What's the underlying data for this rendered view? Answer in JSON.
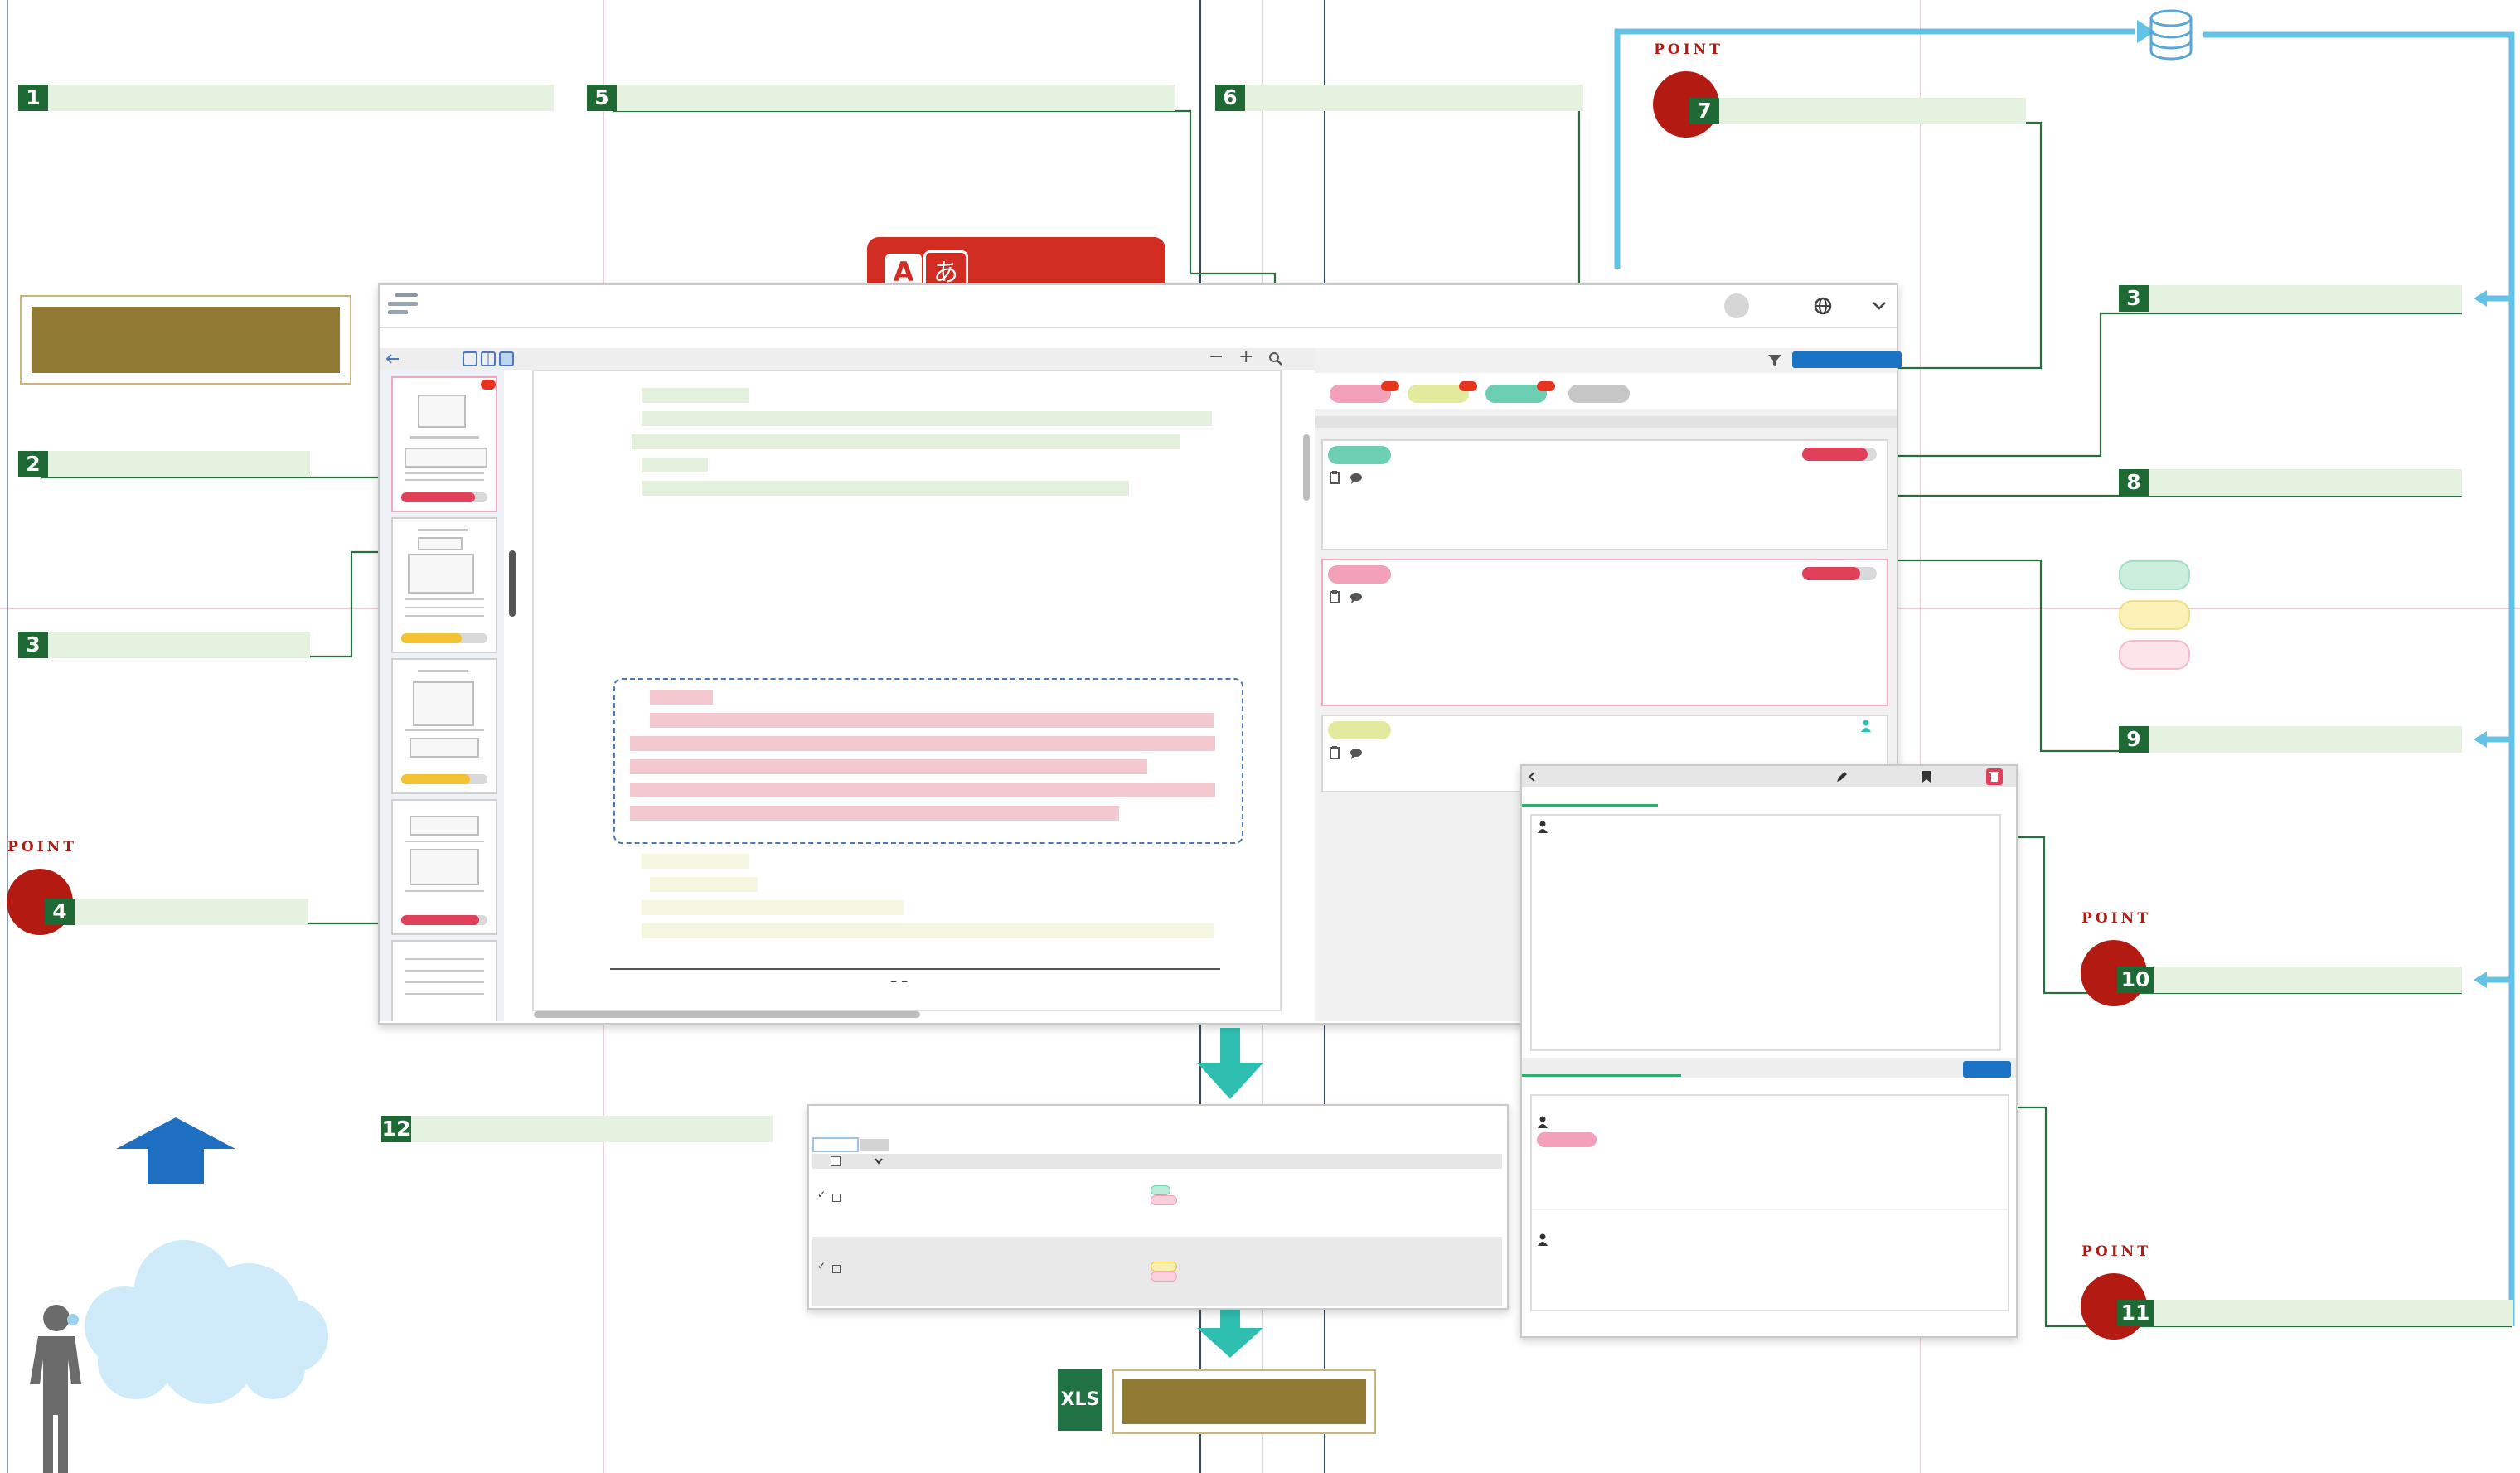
{
  "callouts": {
    "c1": "1",
    "c2": "2",
    "c3a": "3",
    "c3b": "3",
    "c4": "4",
    "c5": "5",
    "c6": "6",
    "c7": "7",
    "c8": "8",
    "c9": "9",
    "c10": "10",
    "c11": "11",
    "c12": "12"
  },
  "point_label": "POINT",
  "translate_badge": {
    "latin": "A",
    "kana": "あ"
  },
  "viewer": {
    "zoom_minus": "−",
    "zoom_plus": "+",
    "page_number": "– –"
  },
  "export": {
    "xls_label": "XLS"
  },
  "colors": {
    "callout_green": "#1f6a34",
    "callout_bar": "#e4f2df",
    "point_red": "#b31a12",
    "blue_button": "#1a73c4",
    "cyan_arrow": "#63c3e7",
    "teal_arrow": "#2fbfb0",
    "gold": "#907a33",
    "tag_green": "#6ccfb3",
    "tag_yellow": "#e3ea9e",
    "tag_pink": "#f2a1b8",
    "progress_red": "#e0405a",
    "progress_yellow": "#f2c233"
  },
  "icons": [
    "user-avatar-icon",
    "globe-icon",
    "chevron-down-icon",
    "filter-icon",
    "zoom-icon",
    "clipboard-icon",
    "comment-icon",
    "person-icon",
    "pencil-icon",
    "bookmark-icon",
    "trash-icon",
    "database-icon",
    "user-silhouette-icon",
    "cloud-icon",
    "up-arrow-icon",
    "down-arrow-icon",
    "back-arrow-icon"
  ]
}
